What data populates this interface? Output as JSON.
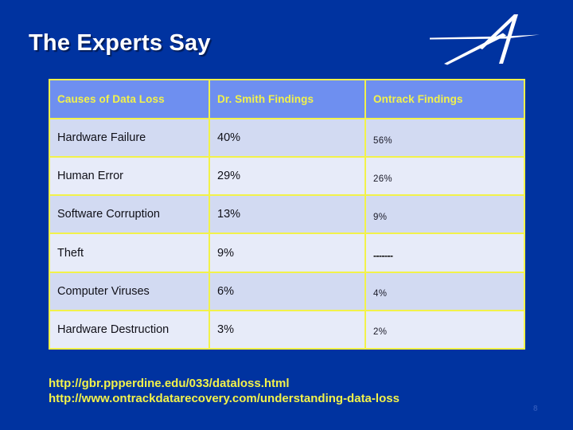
{
  "slide": {
    "title": "The Experts Say",
    "background_color": "#0033a0",
    "title_color": "#ffffff",
    "page_number": "8"
  },
  "logo": {
    "name": "stylized-a-logo",
    "color": "#ffffff"
  },
  "table": {
    "border_color": "#f2f24a",
    "header_background": "#6e8ff0",
    "header_text_color": "#f2f24a",
    "row_dark_background": "#d2daf2",
    "row_light_background": "#e7ebf9",
    "headers": [
      "Causes of Data Loss",
      "Dr. Smith Findings",
      "Ontrack Findings"
    ],
    "rows": [
      {
        "cause": "Hardware Failure",
        "smith": "40%",
        "ontrack": "56%"
      },
      {
        "cause": "Human Error",
        "smith": "29%",
        "ontrack": "26%"
      },
      {
        "cause": "Software Corruption",
        "smith": "13%",
        "ontrack": "9%"
      },
      {
        "cause": "Theft",
        "smith": "9%",
        "ontrack": "-------"
      },
      {
        "cause": "Computer Viruses",
        "smith": "6%",
        "ontrack": "4%"
      },
      {
        "cause": "Hardware Destruction",
        "smith": "3%",
        "ontrack": "2%"
      }
    ]
  },
  "footer": {
    "links": [
      "http://gbr.ppperdine.edu/033/dataloss.html",
      "http://www.ontrackdatarecovery.com/understanding-data-loss"
    ],
    "color": "#f2f24a"
  }
}
